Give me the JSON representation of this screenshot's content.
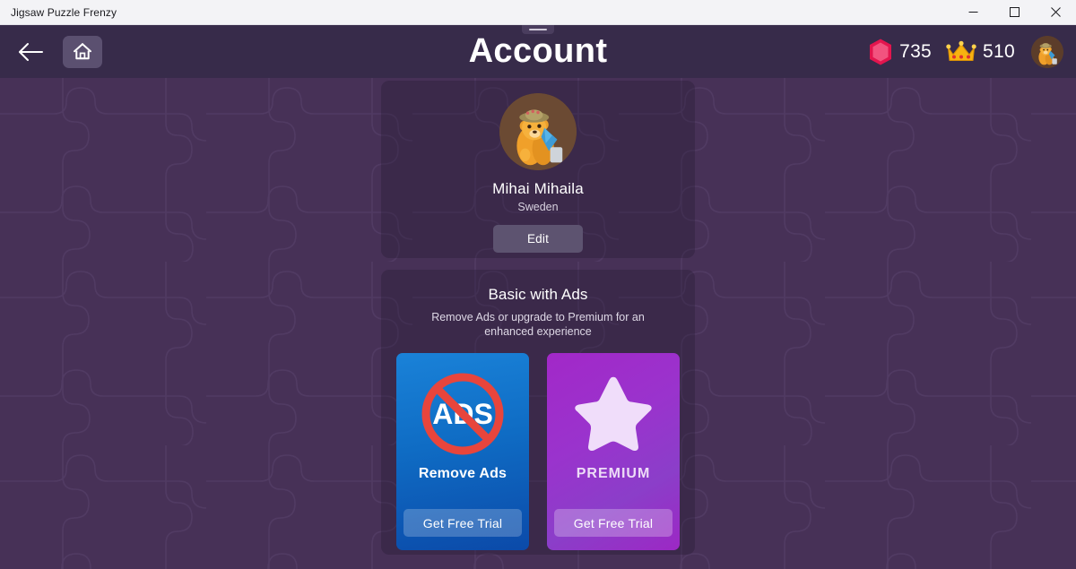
{
  "titlebar": {
    "app_title": "Jigsaw Puzzle Frenzy",
    "minimize_label": "Minimize",
    "maximize_label": "Maximize",
    "close_label": "Close"
  },
  "header": {
    "title": "Account",
    "back_icon": "arrow-left-icon",
    "home_icon": "home-icon",
    "drag_handle": "window-drag-handle",
    "currencies": [
      {
        "icon": "gem-icon",
        "amount": "735",
        "color": "#e8255f"
      },
      {
        "icon": "crown-icon",
        "amount": "510",
        "color": "#f5b21a"
      }
    ],
    "avatar_icon": "user-avatar-bear-icon"
  },
  "profile": {
    "avatar_icon": "profile-avatar-bear-icon",
    "name": "Mihai Mihaila",
    "country": "Sweden",
    "edit_label": "Edit"
  },
  "subscription": {
    "plan_title": "Basic with Ads",
    "description": "Remove Ads or upgrade to Premium for an enhanced experience",
    "offers": [
      {
        "id": "remove-ads",
        "icon": "no-ads-icon",
        "icon_text": "ADS",
        "label": "Remove Ads",
        "cta": "Get Free Trial",
        "accent": "#0f6cc4"
      },
      {
        "id": "premium",
        "icon": "star-icon",
        "label": "PREMIUM",
        "cta": "Get Free Trial",
        "accent": "#9a33cd"
      }
    ]
  },
  "theme": {
    "background": "#473157",
    "header_background": "#372b4a",
    "panel_background": "#3c2f50",
    "titlebar_background": "#f3f3f6"
  }
}
